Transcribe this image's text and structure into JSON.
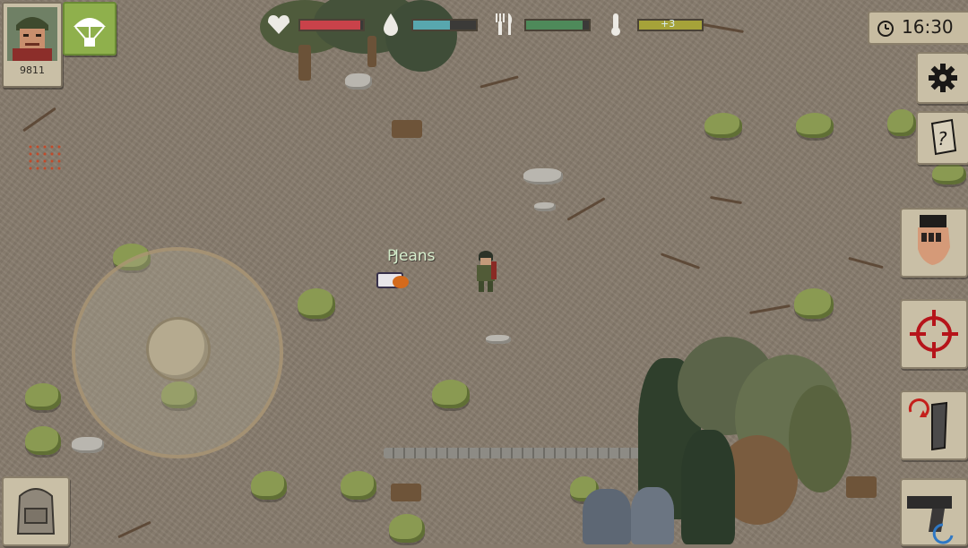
{
  "hud": {
    "player_money": "9811",
    "clock_time": "16:30",
    "temperature_badge": "+3",
    "stats": [
      {
        "name": "health",
        "icon": "heart-icon",
        "level": 0.96,
        "color": "#c9424a"
      },
      {
        "name": "thirst",
        "icon": "water-drop-icon",
        "level": 0.58,
        "color": "#58a7ae"
      },
      {
        "name": "hunger",
        "icon": "fork-knife-icon",
        "level": 0.9,
        "color": "#4e8a5a"
      },
      {
        "name": "temperature",
        "icon": "thermometer-icon",
        "level": 1.0,
        "color": "#a6a339"
      }
    ]
  },
  "world": {
    "item_label": "Jeans",
    "item_label_overlap": "P"
  },
  "side_buttons": [
    {
      "id": "settings",
      "icon": "gear-icon"
    },
    {
      "id": "quests",
      "icon": "notepad-question-icon"
    },
    {
      "id": "melee",
      "icon": "punch-fist-icon"
    },
    {
      "id": "aim",
      "icon": "crosshair-icon"
    },
    {
      "id": "reload",
      "icon": "reload-magazine-icon"
    },
    {
      "id": "weapon",
      "icon": "pistol-icon"
    }
  ],
  "colors": {
    "ground": "#877b6d",
    "panel": "#c9bfa6",
    "airdrop": "#8fb04c"
  }
}
